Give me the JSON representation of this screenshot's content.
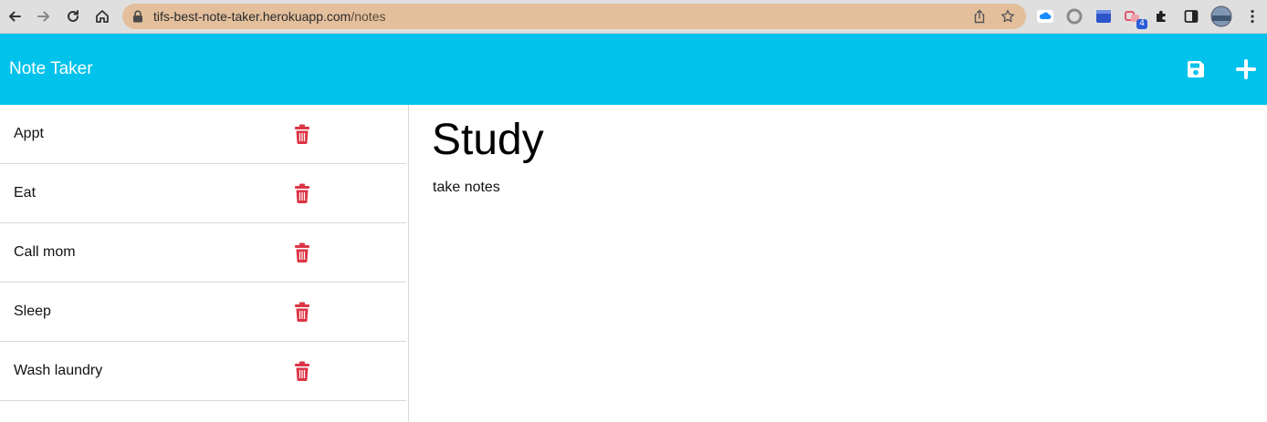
{
  "browser": {
    "url_host": "tifs-best-note-taker.herokuapp.com",
    "url_path": "/notes",
    "extension_badge": "4"
  },
  "header": {
    "brand": "Note Taker",
    "save_icon": "save-icon",
    "new_icon": "plus-icon",
    "color": "#00c2eb"
  },
  "notes": [
    {
      "title": "Appt"
    },
    {
      "title": "Eat"
    },
    {
      "title": "Call mom"
    },
    {
      "title": "Sleep"
    },
    {
      "title": "Wash laundry"
    }
  ],
  "active_note": {
    "title": "Study",
    "text": "take notes"
  },
  "colors": {
    "delete": "#dc3545"
  }
}
